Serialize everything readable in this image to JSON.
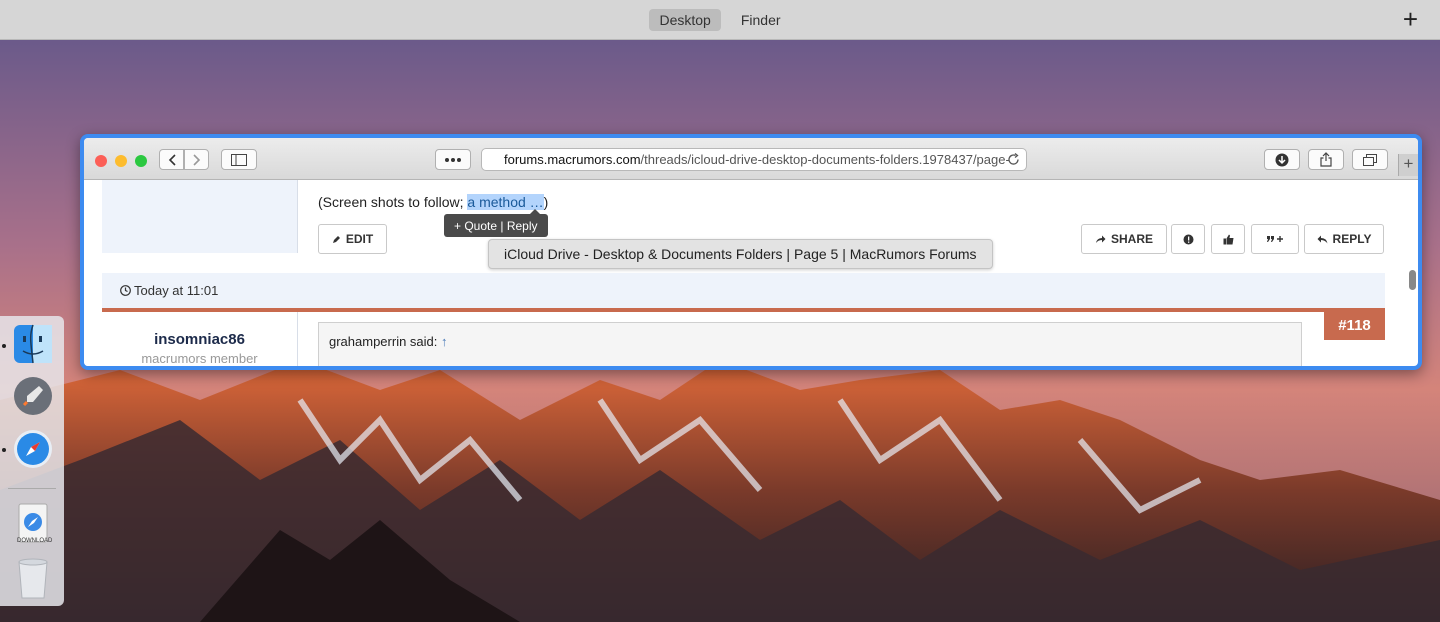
{
  "mission_control": {
    "spaces": [
      "Desktop",
      "Finder"
    ],
    "active_space": "Desktop",
    "add_label": "+"
  },
  "browser": {
    "url_domain": "forums.macrumors.com",
    "url_path": "/threads/icloud-drive-desktop-documents-folders.1978437/page-",
    "new_tab_label": "+"
  },
  "post_prev": {
    "text_before": "(Screen shots to follow; ",
    "highlighted": "a method …",
    "text_after": ")",
    "quote_popup": "+ Quote | Reply",
    "edit_label": "EDIT",
    "share_label": "SHARE",
    "reply_label": "REPLY"
  },
  "tooltip": "iCloud Drive - Desktop & Documents Folders | Page 5 | MacRumors Forums",
  "post_next": {
    "timestamp": "Today at 11:01",
    "number": "#118",
    "username": "insomniac86",
    "user_title": "macrumors member",
    "quote_author": "grahamperrin said:",
    "quote_arrow": "↑"
  },
  "dock": {
    "download_label": "DOWNLOAD"
  },
  "colors": {
    "accent": "#c86a4e",
    "window_border": "#3d8bf0",
    "highlight": "#b3d4fc"
  }
}
